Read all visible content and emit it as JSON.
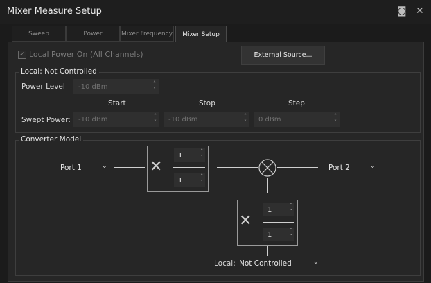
{
  "window": {
    "title": "Mixer Measure Setup",
    "camera_icon": "camera-icon",
    "close_icon": "close-icon",
    "close_glyph": "✕",
    "camera_glyph": "◙"
  },
  "tabs": [
    {
      "label": "Sweep",
      "active": false
    },
    {
      "label": "Power",
      "active": false
    },
    {
      "label": "Mixer Frequency",
      "active": false
    },
    {
      "label": "Mixer Setup",
      "active": true
    }
  ],
  "local_power": {
    "label": "Local Power On (All Channels)",
    "checked": true,
    "check_glyph": "✓"
  },
  "external_source_button": "External Source...",
  "local_group": {
    "title": "Local: Not Controlled",
    "power_level_label": "Power Level",
    "power_level_value": "-10 dBm",
    "start_label": "Start",
    "stop_label": "Stop",
    "step_label": "Step",
    "swept_power_label": "Swept Power:",
    "swept_start": "-10 dBm",
    "swept_stop": "-10 dBm",
    "swept_step": "0 dBm"
  },
  "converter_group": {
    "title": "Converter Model",
    "port1": "Port 1",
    "port2": "Port 2",
    "multiplier1_numerator": "1",
    "multiplier1_denominator": "1",
    "multiplier2_numerator": "1",
    "multiplier2_denominator": "1",
    "local_label": "Local:",
    "local_value": "Not Controlled",
    "times_glyph": "✕"
  },
  "arrows": {
    "up": "˄",
    "down": "˅",
    "chevron": "⌄"
  },
  "colors": {
    "background": "#262626",
    "titlebar": "#1e1e1e",
    "line": "#cfcfcf",
    "disabled_text": "#7a7a7a"
  }
}
